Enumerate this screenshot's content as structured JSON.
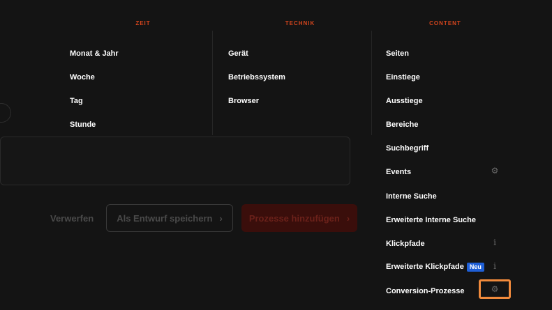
{
  "background": {
    "discard_label": "Verwerfen",
    "save_draft_label": "Als Entwurf speichern",
    "add_processes_label": "Prozesse hinzufügen",
    "chevron": "›"
  },
  "columns": {
    "zeit": {
      "header": "ZEIT",
      "items": [
        "Monat & Jahr",
        "Woche",
        "Tag",
        "Stunde"
      ]
    },
    "technik": {
      "header": "TECHNIK",
      "items": [
        "Gerät",
        "Betriebssystem",
        "Browser"
      ]
    },
    "content": {
      "header": "CONTENT",
      "items": [
        "Seiten",
        "Einstiege",
        "Ausstiege",
        "Bereiche",
        "Suchbegriff",
        "Events",
        "Interne Suche",
        "Erweiterte Interne Suche",
        "Klickpfade",
        "Erweiterte Klickpfade",
        "Conversion-Prozesse"
      ],
      "new_badge": "Neu"
    }
  },
  "icons": {
    "events": "gear-icon",
    "klickpfade": "info-icon",
    "erweiterte_klickpfade": "info-icon",
    "conversion_prozesse": "gear-icon"
  },
  "colors": {
    "header_accent": "#d4451d",
    "highlight": "#f08a3c",
    "badge": "#1f5fd6"
  }
}
